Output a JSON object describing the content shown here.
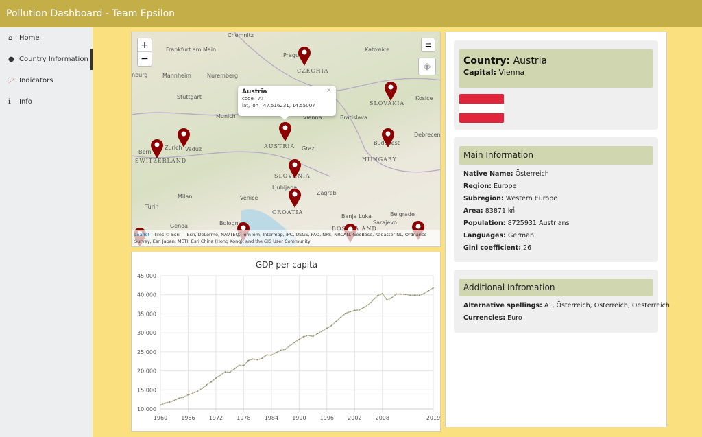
{
  "header": {
    "title": "Pollution Dashboard - Team Epsilon"
  },
  "sidebar": {
    "items": [
      {
        "label": "Home",
        "icon": "home-icon",
        "glyph": "⌂"
      },
      {
        "label": "Country Information",
        "icon": "globe-icon",
        "glyph": "●"
      },
      {
        "label": "Indicators",
        "icon": "line-chart-icon",
        "glyph": "📈"
      },
      {
        "label": "Info",
        "icon": "info-icon",
        "glyph": "ℹ"
      }
    ],
    "active": 1
  },
  "map": {
    "zoom_in": "+",
    "zoom_out": "−",
    "popup": {
      "title": "Austria",
      "code": "code : AT",
      "latlon": "lat, lon : 47.516231, 14.55007",
      "close": "×"
    },
    "cities": [
      "Chemnitz",
      "Prague",
      "Katowice",
      "Frankfurt am Main",
      "Nuremberg",
      "Mannheim",
      "Stuttgart",
      "Munich",
      "Vienna",
      "Bratislava",
      "Kosice",
      "Debrecen",
      "Bern",
      "Zurich",
      "Vaduz",
      "Graz",
      "Budapest",
      "Ljubljana",
      "Zagreb",
      "Milan",
      "Venice",
      "Turin",
      "Genoa",
      "Bologna",
      "Banja Luka",
      "Belgrade",
      "Sarajevo",
      "nburg"
    ],
    "countries": [
      "CZECHIA",
      "SLOVAKIA",
      "AUSTRIA",
      "HUNGARY",
      "SWITZERLAND",
      "SLOVENIA",
      "CROATIA",
      "BOSNIA AND"
    ],
    "attribution_link": "Leaflet",
    "attribution": " | Tiles © Esri — Esri, DeLorme, NAVTEQ, TomTom, Intermap, iPC, USGS, FAO, NPS, NRCAN, GeoBase, Kadaster NL, Ordnance Survey, Esri Japan, METI, Esri China (Hong Kong), and the GIS User Community",
    "marker_color": "#8b0000"
  },
  "chart_data": {
    "type": "line",
    "title": "GDP per capita",
    "xlabel": "",
    "ylabel": "",
    "x": [
      1960,
      1961,
      1962,
      1963,
      1964,
      1965,
      1966,
      1967,
      1968,
      1969,
      1970,
      1971,
      1972,
      1973,
      1974,
      1975,
      1976,
      1977,
      1978,
      1979,
      1980,
      1981,
      1982,
      1983,
      1984,
      1985,
      1986,
      1987,
      1988,
      1989,
      1990,
      1991,
      1992,
      1993,
      1994,
      1995,
      1996,
      1997,
      1998,
      1999,
      2000,
      2001,
      2002,
      2003,
      2004,
      2005,
      2006,
      2007,
      2008,
      2009,
      2010,
      2011,
      2012,
      2013,
      2014,
      2015,
      2016,
      2017,
      2018,
      2019
    ],
    "values": [
      11000,
      11500,
      11800,
      12200,
      12800,
      13100,
      13700,
      14100,
      14600,
      15400,
      16300,
      17100,
      18100,
      18900,
      19700,
      19600,
      20500,
      21500,
      21400,
      22700,
      23100,
      22900,
      23300,
      24200,
      24100,
      24800,
      25400,
      25700,
      26600,
      27500,
      28300,
      29000,
      29300,
      29100,
      29800,
      30500,
      31200,
      31900,
      33000,
      34100,
      35100,
      35500,
      35900,
      36000,
      36700,
      37400,
      38600,
      39800,
      40300,
      38600,
      39200,
      40200,
      40200,
      40100,
      39900,
      39900,
      39900,
      40300,
      41100,
      41800
    ],
    "xticks": [
      "1960",
      "1966",
      "1972",
      "1978",
      "1984",
      "1990",
      "1996",
      "2002",
      "2008",
      "2019"
    ],
    "yticks": [
      "10.000",
      "15.000",
      "20.000",
      "25.000",
      "30.000",
      "35.000",
      "40.000",
      "45.000"
    ],
    "ylim": [
      10000,
      45000
    ],
    "xlim": [
      1960,
      2019
    ],
    "grid": true,
    "line_color": "#a8a888"
  },
  "country": {
    "country_label": "Country:",
    "country": "Austria",
    "capital_label": "Capital:",
    "capital": "Vienna",
    "flag_colors": [
      "#e0253c",
      "#ffffff",
      "#e0253c"
    ]
  },
  "main_info": {
    "title": "Main Information",
    "rows": [
      {
        "k": "Native Name:",
        "v": "Österreich"
      },
      {
        "k": "Region:",
        "v": "Europe"
      },
      {
        "k": "Subregion:",
        "v": "Western Europe"
      },
      {
        "k": "Area:",
        "v": "83871 ㎢"
      },
      {
        "k": "Population:",
        "v": "8725931 Austrians"
      },
      {
        "k": "Languages:",
        "v": "German"
      },
      {
        "k": "Gini coefficient:",
        "v": "26"
      }
    ]
  },
  "additional_info": {
    "title": "Additional Infromation",
    "rows": [
      {
        "k": "Alternative spellings:",
        "v": "AT, Österreich, Osterreich, Oesterreich"
      },
      {
        "k": "Currencies:",
        "v": "Euro"
      }
    ]
  }
}
